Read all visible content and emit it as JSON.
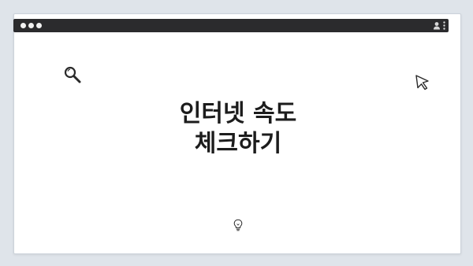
{
  "app": {
    "pager": {
      "count": 4
    },
    "titlebar": {
      "traffic_lights": [
        "dot",
        "dot",
        "dot"
      ],
      "icons": [
        "user-icon",
        "more-vertical-icon"
      ],
      "color": "#2b2b2d"
    },
    "content": {
      "headline": "인터넷 속도\n체크하기",
      "icons": [
        "search-icon",
        "cursor-icon",
        "lightbulb-icon"
      ]
    },
    "colors": {
      "background": "#dfe4ea",
      "window": "#ffffff",
      "text": "#1c1c1c"
    }
  }
}
